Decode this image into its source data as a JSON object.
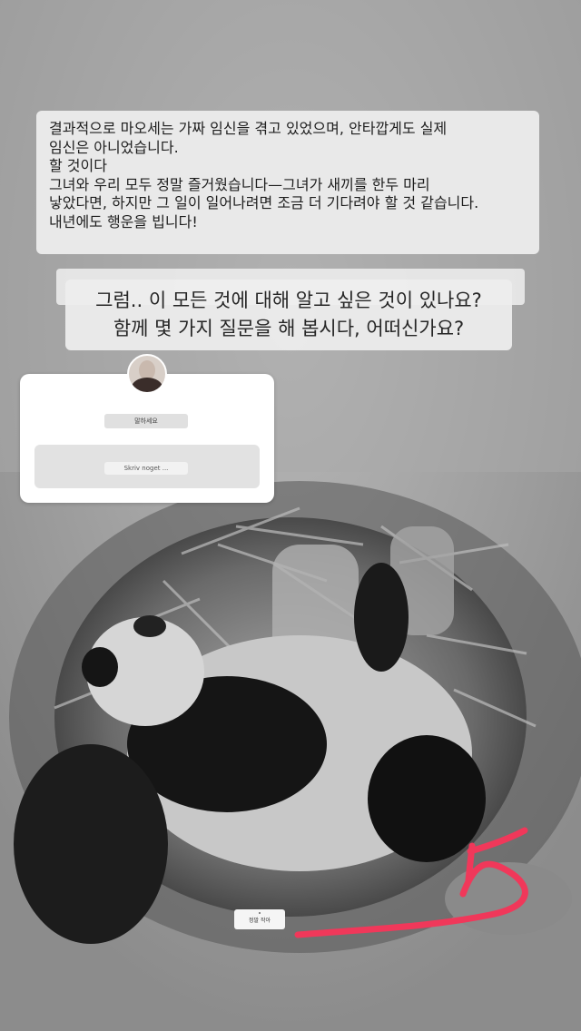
{
  "caption_main": {
    "lines": [
      "결과적으로 마오세는 가짜 임신을 겪고 있었으며, 안타깝게도 실제",
      "임신은 아니었습니다.",
      "할 것이다",
      "그녀와 우리 모두 정말 즐거웠습니다—그녀가 새끼를 한두 마리",
      "낳았다면, 하지만 그 일이 일어나려면 조금 더 기다려야 할 것 같습니다.",
      "내년에도 행운을 빕니다!"
    ]
  },
  "caption_big": {
    "lines": [
      "그럼.. 이 모든 것에 대해 알고 싶은 것이 있나요?",
      "함께 몇 가지 질문을 해 봅시다, 어떠신가요?"
    ]
  },
  "question_sticker": {
    "prompt": "말하세요",
    "placeholder": "Skriv noget ..."
  },
  "tag_sticker": {
    "label": "정말 작아"
  },
  "colors": {
    "arrow": "#f0385a",
    "card": "#ffffff",
    "caption_bg": "#eeeeee"
  },
  "icons": [
    "avatar"
  ]
}
